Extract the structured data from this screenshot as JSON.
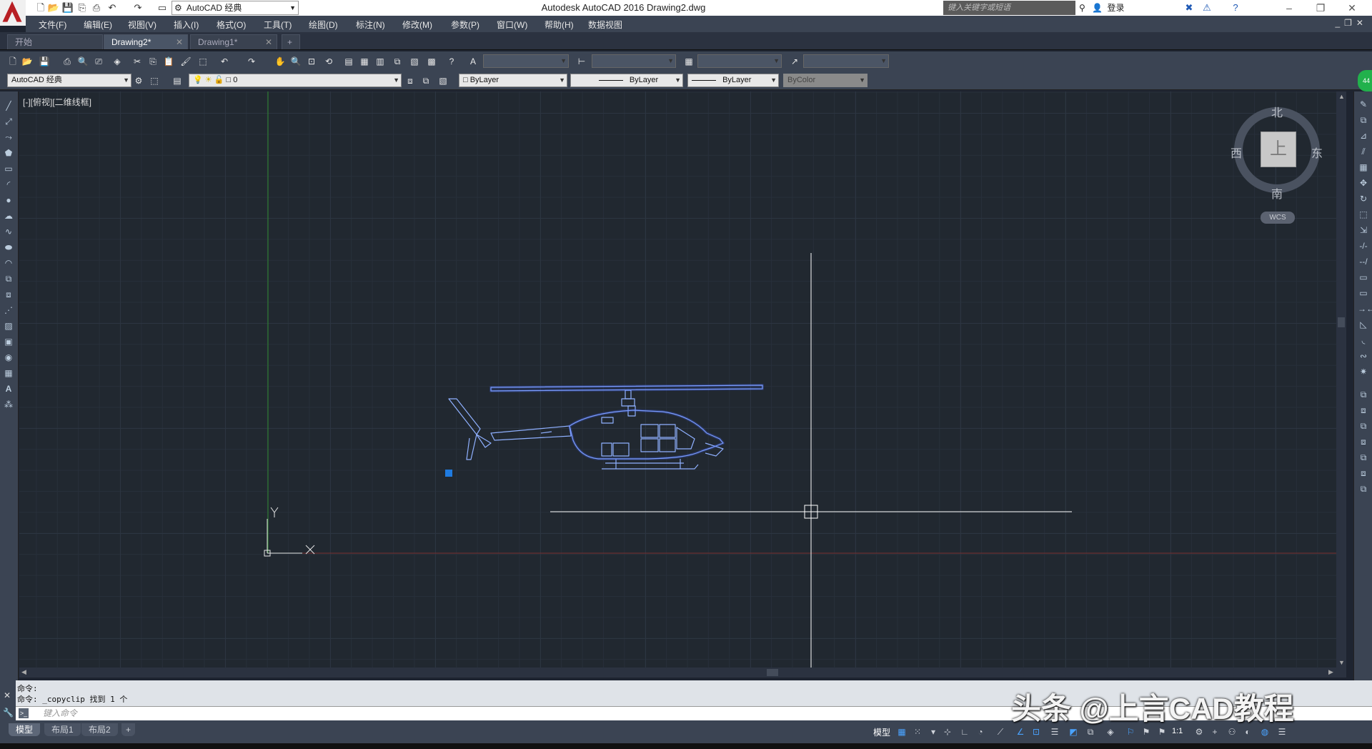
{
  "titlebar": {
    "workspace": "AutoCAD 经典",
    "title": "Autodesk AutoCAD 2016    Drawing2.dwg",
    "search_placeholder": "键入关键字或短语",
    "login": "登录"
  },
  "menu": [
    "文件(F)",
    "编辑(E)",
    "视图(V)",
    "插入(I)",
    "格式(O)",
    "工具(T)",
    "绘图(D)",
    "标注(N)",
    "修改(M)",
    "参数(P)",
    "窗口(W)",
    "帮助(H)",
    "数据视图"
  ],
  "tabs": [
    {
      "label": "开始"
    },
    {
      "label": "Drawing2*"
    },
    {
      "label": "Drawing1*"
    }
  ],
  "toolbar2": {
    "workspace": "AutoCAD 经典",
    "layer": "0",
    "color": "ByLayer",
    "linetype": "ByLayer",
    "lineweight": "ByLayer",
    "plotstyle": "ByColor"
  },
  "viewport": {
    "label": "[-][俯视][二维线框]"
  },
  "viewcube": {
    "north": "北",
    "south": "南",
    "east": "东",
    "west": "西",
    "face": "上",
    "wcs": "WCS"
  },
  "ucs": {
    "x": "X",
    "y": "Y"
  },
  "command": {
    "history": [
      "命令:",
      "命令: _copyclip 找到 1 个"
    ],
    "placeholder": "键入命令"
  },
  "statusbar": {
    "layouts": [
      "模型",
      "布局1",
      "布局2"
    ],
    "model_label": "模型",
    "scale": "1:1"
  },
  "watermark": "头条 @上言CAD教程",
  "colors": {
    "canvas": "#212830",
    "helicopter": "#5b8cff",
    "y_axis": "#2f8a2f",
    "x_axis": "#8a2f2f"
  }
}
